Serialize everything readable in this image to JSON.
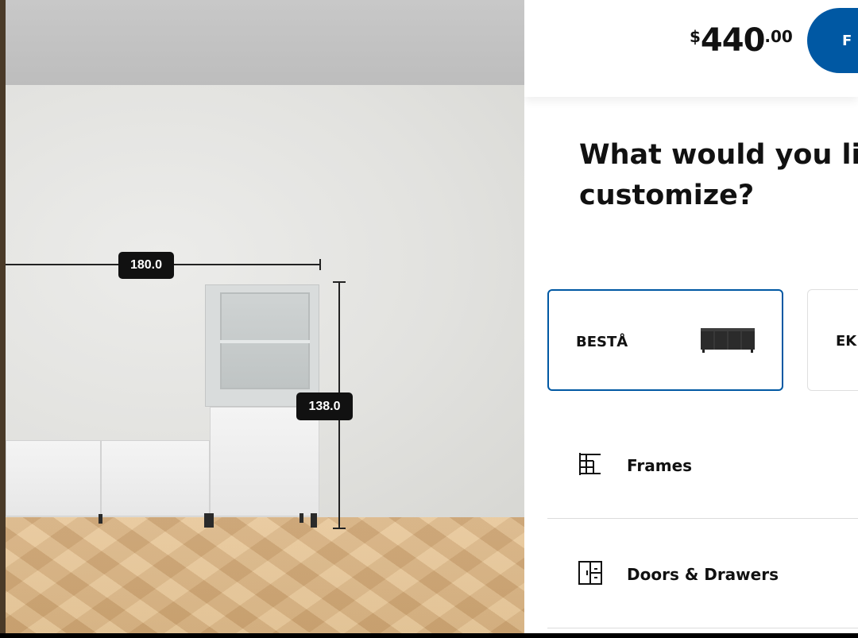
{
  "scene": {
    "width_label": "180.0",
    "height_label": "138.0"
  },
  "header": {
    "price_currency": "$",
    "price_integer": "440",
    "price_decimal": ".00",
    "primary_button_label": "F"
  },
  "customize": {
    "heading_line1": "What would you lik",
    "heading_line2": "customize?"
  },
  "series": [
    {
      "name": "BESTÅ",
      "selected": true
    },
    {
      "name": "EK",
      "selected": false
    }
  ],
  "menu": [
    {
      "label": "Frames",
      "icon": "frames-icon"
    },
    {
      "label": "Doors & Drawers",
      "icon": "doors-drawers-icon"
    }
  ],
  "colors": {
    "brand_blue": "#0058a3",
    "dimension_label_bg": "#111111"
  }
}
